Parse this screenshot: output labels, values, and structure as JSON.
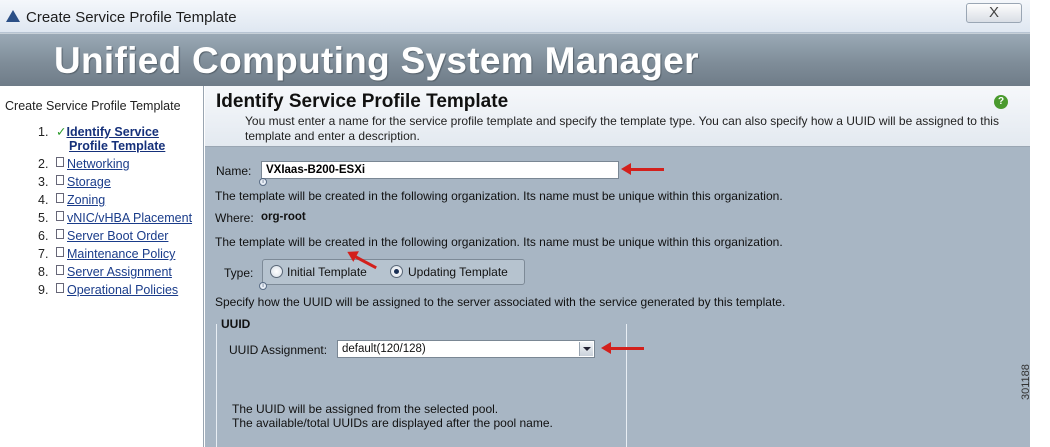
{
  "window": {
    "title": "Create Service Profile Template",
    "close_label": "X"
  },
  "banner": {
    "title": "Unified Computing System Manager"
  },
  "sidebar": {
    "title": "Create Service Profile Template",
    "steps": [
      {
        "num": "1.",
        "check": "✓",
        "label_line1": "Identify Service",
        "label_line2": "Profile Template"
      },
      {
        "num": "2.",
        "label": "Networking"
      },
      {
        "num": "3.",
        "label": "Storage"
      },
      {
        "num": "4.",
        "label": "Zoning"
      },
      {
        "num": "5.",
        "label": "vNIC/vHBA Placement"
      },
      {
        "num": "6.",
        "label": "Server Boot Order"
      },
      {
        "num": "7.",
        "label": "Maintenance Policy"
      },
      {
        "num": "8.",
        "label": "Server Assignment"
      },
      {
        "num": "9.",
        "label": "Operational Policies"
      }
    ]
  },
  "main": {
    "title": "Identify Service Profile Template",
    "description": "You must enter a name for the service profile template and specify the template type. You can also specify how a UUID will be assigned to this template and enter a description.",
    "help_icon": "?",
    "name_label": "Name:",
    "name_value": "VXIaas-B200-ESXi",
    "org_text_1": "The template will be created in the following organization. Its name must be unique within this organization.",
    "where_label": "Where:",
    "where_value": "org-root",
    "org_text_2": "The template will be created in the following organization. Its name must be unique within this organization.",
    "type_label": "Type:",
    "type_options": [
      {
        "label": "Initial Template",
        "selected": false
      },
      {
        "label": "Updating Template",
        "selected": true
      }
    ],
    "uuid_text": "Specify how the UUID will be assigned to the server associated with the service generated by this template.",
    "uuid": {
      "legend": "UUID",
      "assignment_label": "UUID Assignment:",
      "assignment_value": "default(120/128)",
      "note_1": "The UUID will be assigned from the selected pool.",
      "note_2": "The available/total UUIDs are displayed after the pool name."
    },
    "info_marker": "i",
    "annotation_color": "#d3201c"
  },
  "figure_id": "301188"
}
